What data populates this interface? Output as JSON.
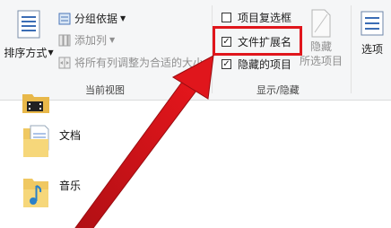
{
  "ribbon": {
    "sort_by": "排序方式",
    "group_by": "分组依据",
    "add_columns": "添加列",
    "fit_columns": "将所有列调整为合适的大小",
    "current_view_label": "当前视图",
    "item_checkboxes": "项目复选框",
    "file_extensions": "文件扩展名",
    "hidden_items": "隐藏的项目",
    "hide": "隐藏",
    "hide_selected": "所选项目",
    "show_hide_label": "显示/隐藏",
    "options": "选项",
    "checkboxes_state": {
      "item_checkboxes": false,
      "file_extensions": true,
      "hidden_items": true
    }
  },
  "files": [
    {
      "name": "",
      "icon": "video-folder-icon"
    },
    {
      "name": "文档",
      "icon": "documents-folder-icon"
    },
    {
      "name": "音乐",
      "icon": "music-folder-icon"
    }
  ],
  "annotation": {
    "color": "#e0161c"
  }
}
